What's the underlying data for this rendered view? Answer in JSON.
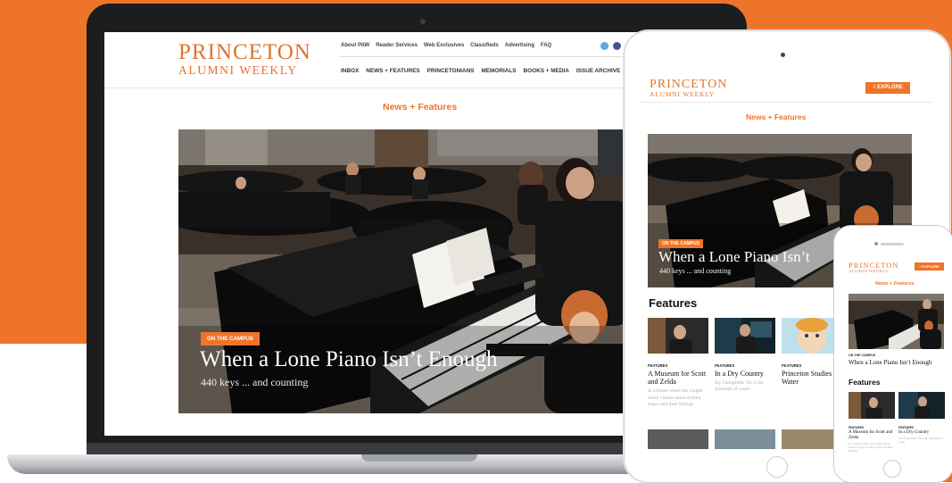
{
  "brand": {
    "logo_line1": "PRINCETON",
    "logo_line2": "ALUMNI WEEKLY",
    "accent": "#ee7429"
  },
  "top_nav": [
    "About PAW",
    "Reader Services",
    "Web Exclusives",
    "Classifieds",
    "Advertising",
    "FAQ"
  ],
  "main_nav": [
    "INBOX",
    "NEWS + FEATURES",
    "PRINCETONIANS",
    "MEMORIALS",
    "BOOKS + MEDIA",
    "ISSUE ARCHIVE"
  ],
  "section_title": "News + Features",
  "hero": {
    "tag": "ON THE CAMPUS",
    "headline": "When a Lone Piano Isn’t Enough",
    "tablet_headline": "When a Lone Piano Isn’t",
    "dek": "440 keys ... and counting",
    "image": "piano-room-photo"
  },
  "explore_label": "≡ EXPLORE",
  "features": {
    "heading": "Features",
    "cards": [
      {
        "kicker": "FEATURES",
        "title": "A Museum for Scott and Zelda",
        "desc": "In a house where the couple lived, visitors learn of their hopes and their failings",
        "image": "portrait-photo"
      },
      {
        "kicker": "FEATURES",
        "title": "In a Dry Country",
        "desc": "Jay Famiglietti ’82 is the Jeremiah of water",
        "image": "man-with-screens-photo"
      },
      {
        "kicker": "FEATURES",
        "title": "Princeton Studies Water",
        "desc": "",
        "image": "illustration-face"
      }
    ]
  },
  "social_icons": [
    "twitter-icon",
    "facebook-icon"
  ]
}
